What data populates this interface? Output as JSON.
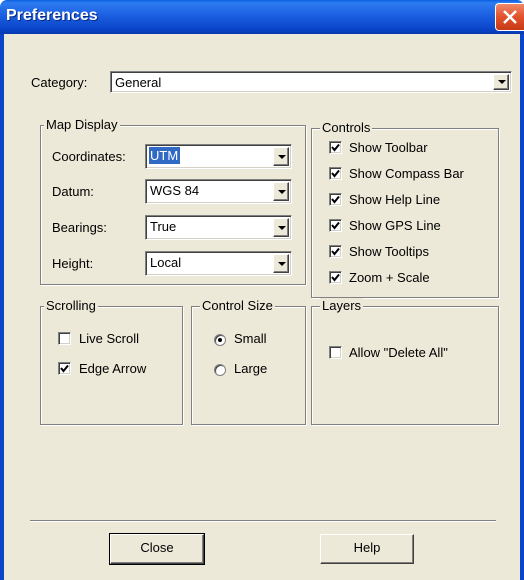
{
  "window": {
    "title": "Preferences",
    "colors": {
      "titlebar": "#0a45c9",
      "face": "#ece9d8",
      "selection": "#316ac5",
      "close": "#e0512c"
    }
  },
  "category": {
    "label": "Category:",
    "value": "General"
  },
  "map_display": {
    "title": "Map Display",
    "coordinates": {
      "label": "Coordinates:",
      "value": "UTM"
    },
    "datum": {
      "label": "Datum:",
      "value": "WGS 84"
    },
    "bearings": {
      "label": "Bearings:",
      "value": "True"
    },
    "height": {
      "label": "Height:",
      "value": "Local"
    }
  },
  "controls": {
    "title": "Controls",
    "items": [
      {
        "label": "Show Toolbar",
        "checked": true
      },
      {
        "label": "Show Compass Bar",
        "checked": true
      },
      {
        "label": "Show Help Line",
        "checked": true
      },
      {
        "label": "Show GPS Line",
        "checked": true
      },
      {
        "label": "Show Tooltips",
        "checked": true
      },
      {
        "label": "Zoom + Scale",
        "checked": true
      }
    ]
  },
  "scrolling": {
    "title": "Scrolling",
    "items": [
      {
        "label": "Live Scroll",
        "checked": false
      },
      {
        "label": "Edge Arrow",
        "checked": true
      }
    ]
  },
  "control_size": {
    "title": "Control Size",
    "options": [
      {
        "label": "Small",
        "selected": true
      },
      {
        "label": "Large",
        "selected": false
      }
    ]
  },
  "layers": {
    "title": "Layers",
    "items": [
      {
        "label": "Allow \"Delete All\"",
        "checked": false
      }
    ]
  },
  "buttons": {
    "close": "Close",
    "help": "Help"
  }
}
